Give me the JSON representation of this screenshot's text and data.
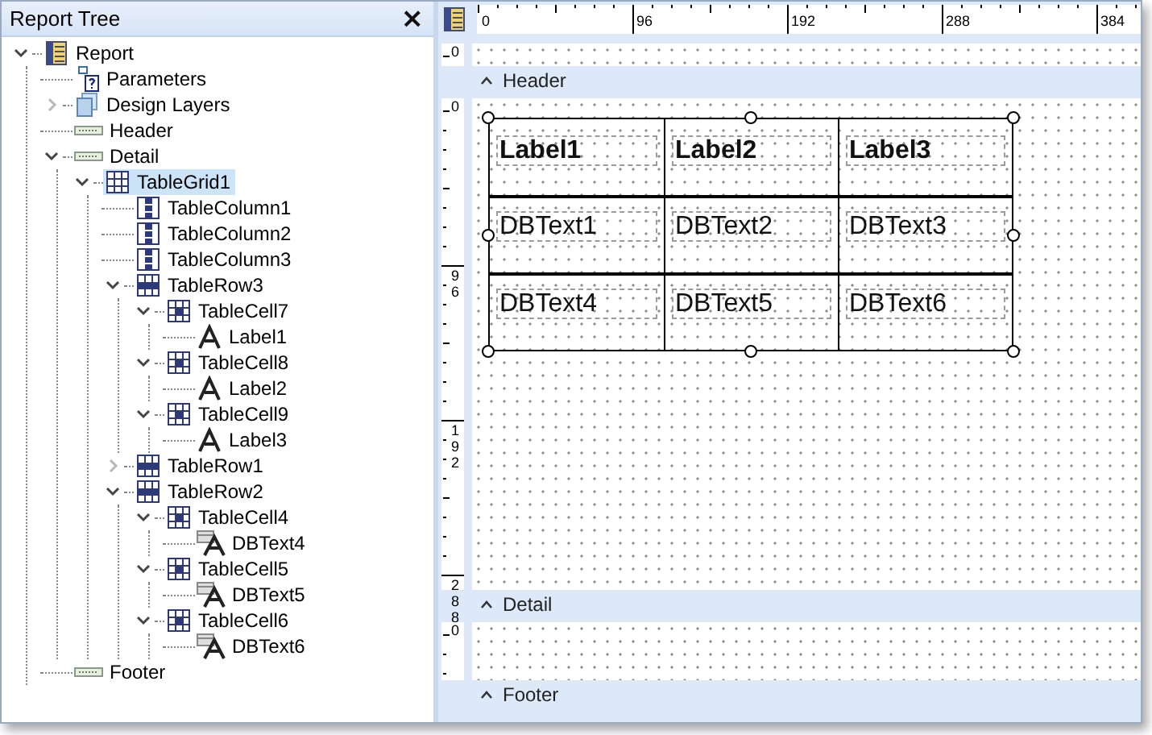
{
  "panel": {
    "title": "Report Tree",
    "close": "×"
  },
  "tree": [
    {
      "kind": "report",
      "label": "Report",
      "expanded": true,
      "selected": false,
      "children": [
        {
          "kind": "parameters",
          "label": "Parameters",
          "selected": false
        },
        {
          "kind": "layers",
          "label": "Design Layers",
          "expanded": false,
          "selected": false
        },
        {
          "kind": "band",
          "label": "Header",
          "selected": false
        },
        {
          "kind": "band",
          "label": "Detail",
          "expanded": true,
          "selected": false,
          "children": [
            {
              "kind": "grid",
              "label": "TableGrid1",
              "expanded": true,
              "selected": true,
              "children": [
                {
                  "kind": "column",
                  "label": "TableColumn1",
                  "selected": false
                },
                {
                  "kind": "column",
                  "label": "TableColumn2",
                  "selected": false
                },
                {
                  "kind": "column",
                  "label": "TableColumn3",
                  "selected": false
                },
                {
                  "kind": "row",
                  "label": "TableRow3",
                  "expanded": true,
                  "selected": false,
                  "children": [
                    {
                      "kind": "cell",
                      "label": "TableCell7",
                      "expanded": true,
                      "selected": false,
                      "children": [
                        {
                          "kind": "label",
                          "label": "Label1",
                          "selected": false
                        }
                      ]
                    },
                    {
                      "kind": "cell",
                      "label": "TableCell8",
                      "expanded": true,
                      "selected": false,
                      "children": [
                        {
                          "kind": "label",
                          "label": "Label2",
                          "selected": false
                        }
                      ]
                    },
                    {
                      "kind": "cell",
                      "label": "TableCell9",
                      "expanded": true,
                      "selected": false,
                      "children": [
                        {
                          "kind": "label",
                          "label": "Label3",
                          "selected": false
                        }
                      ]
                    }
                  ]
                },
                {
                  "kind": "row",
                  "label": "TableRow1",
                  "expanded": false,
                  "selected": false
                },
                {
                  "kind": "row",
                  "label": "TableRow2",
                  "expanded": true,
                  "selected": false,
                  "children": [
                    {
                      "kind": "cell",
                      "label": "TableCell4",
                      "expanded": true,
                      "selected": false,
                      "children": [
                        {
                          "kind": "dbtext",
                          "label": "DBText4",
                          "selected": false
                        }
                      ]
                    },
                    {
                      "kind": "cell",
                      "label": "TableCell5",
                      "expanded": true,
                      "selected": false,
                      "children": [
                        {
                          "kind": "dbtext",
                          "label": "DBText5",
                          "selected": false
                        }
                      ]
                    },
                    {
                      "kind": "cell",
                      "label": "TableCell6",
                      "expanded": true,
                      "selected": false,
                      "children": [
                        {
                          "kind": "dbtext",
                          "label": "DBText6",
                          "selected": false
                        }
                      ]
                    }
                  ]
                }
              ]
            }
          ]
        },
        {
          "kind": "band",
          "label": "Footer",
          "selected": false
        }
      ]
    }
  ],
  "designer": {
    "ruler_ticks": [
      "0",
      "96",
      "192",
      "288",
      "384"
    ],
    "bands": [
      {
        "name": "Header",
        "ruler_labels": [
          "0"
        ]
      },
      {
        "name": "Detail",
        "ruler_labels": [
          "0",
          "96",
          "192",
          "288"
        ],
        "grid": {
          "rows": [
            {
              "cells": [
                {
                  "kind": "label",
                  "text": "Label1"
                },
                {
                  "kind": "label",
                  "text": "Label2"
                },
                {
                  "kind": "label",
                  "text": "Label3"
                }
              ]
            },
            {
              "cells": [
                {
                  "kind": "dbtext",
                  "text": "DBText1"
                },
                {
                  "kind": "dbtext",
                  "text": "DBText2"
                },
                {
                  "kind": "dbtext",
                  "text": "DBText3"
                }
              ]
            },
            {
              "cells": [
                {
                  "kind": "dbtext",
                  "text": "DBText4"
                },
                {
                  "kind": "dbtext",
                  "text": "DBText5"
                },
                {
                  "kind": "dbtext",
                  "text": "DBText6"
                }
              ]
            }
          ]
        }
      },
      {
        "name": "Footer",
        "ruler_labels": [
          "0"
        ]
      }
    ]
  }
}
